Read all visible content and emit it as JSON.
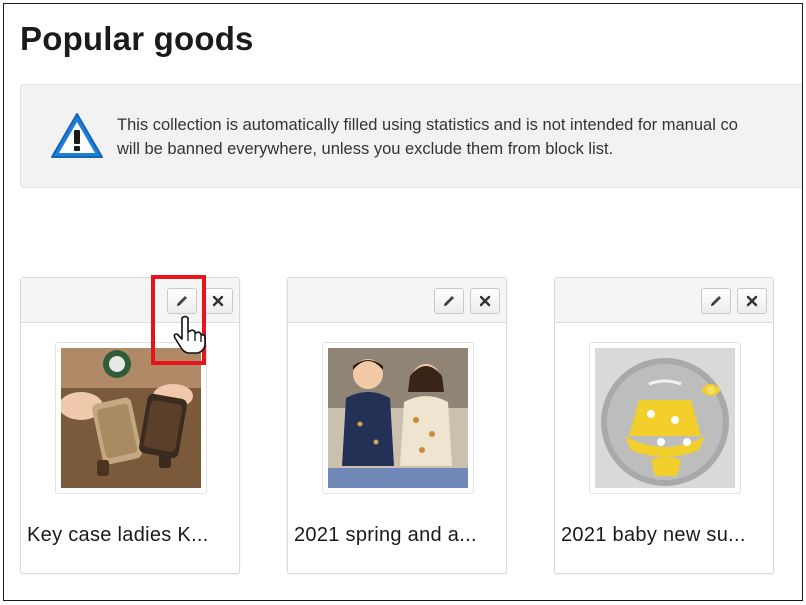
{
  "page": {
    "title": "Popular goods"
  },
  "alert": {
    "icon": "warning-triangle-icon",
    "line1": "This collection is automatically filled using statistics and is not intended for manual co",
    "line2": "will be banned everywhere, unless you exclude them from block list."
  },
  "products": [
    {
      "title": "Key case ladies K...",
      "image": "key-case-photo"
    },
    {
      "title": "2021 spring and a...",
      "image": "kids-pajamas-photo"
    },
    {
      "title": "2021 baby new su...",
      "image": "baby-dress-photo"
    }
  ],
  "toolbar_icons": {
    "edit": "pencil-icon",
    "remove": "close-icon"
  },
  "colors": {
    "highlight": "#e8141b",
    "alert_bg": "#f2f2f2",
    "icon_blue": "#1e7fd6"
  }
}
